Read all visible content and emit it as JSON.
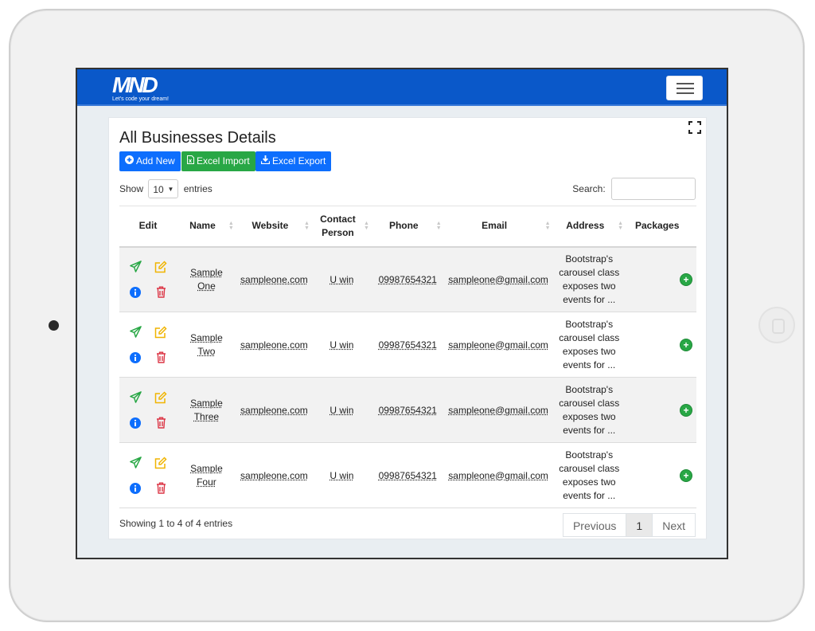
{
  "brand": {
    "logo_text": "MND",
    "tagline": "Let's code your dream!"
  },
  "page": {
    "title": "All Businesses Details"
  },
  "toolbar": {
    "add_label": "Add New",
    "import_label": "Excel Import",
    "export_label": "Excel Export"
  },
  "length": {
    "show_label": "Show",
    "value": "10",
    "entries_label": "entries"
  },
  "search": {
    "label": "Search:",
    "value": ""
  },
  "table": {
    "columns": [
      "Edit",
      "Name",
      "Website",
      "Contact Person",
      "Phone",
      "Email",
      "Address",
      "Packages"
    ],
    "rows": [
      {
        "name": "Sample One",
        "website": "sampleone.com",
        "contact": "U win",
        "phone": "09987654321",
        "email": "sampleone@gmail.com",
        "address": "Bootstrap's carousel class exposes two events for ..."
      },
      {
        "name": "Sample Two",
        "website": "sampleone.com",
        "contact": "U win",
        "phone": "09987654321",
        "email": "sampleone@gmail.com",
        "address": "Bootstrap's carousel class exposes two events for ..."
      },
      {
        "name": "Sample Three",
        "website": "sampleone.com",
        "contact": "U win",
        "phone": "09987654321",
        "email": "sampleone@gmail.com",
        "address": "Bootstrap's carousel class exposes two events for ..."
      },
      {
        "name": "Sample Four",
        "website": "sampleone.com",
        "contact": "U win",
        "phone": "09987654321",
        "email": "sampleone@gmail.com",
        "address": "Bootstrap's carousel class exposes two events for ..."
      }
    ]
  },
  "footer": {
    "info": "Showing 1 to 4 of 4 entries",
    "previous": "Previous",
    "page": "1",
    "next": "Next"
  },
  "colors": {
    "navbar": "#0a58c9",
    "primary": "#0d6efd",
    "success": "#28a745",
    "warning": "#f0b400",
    "danger": "#dc3545"
  },
  "icons": {
    "send": "paper-plane-icon",
    "edit": "pencil-square-icon",
    "info": "info-circle-icon",
    "delete": "trash-icon",
    "package": "plus-circle-icon"
  }
}
